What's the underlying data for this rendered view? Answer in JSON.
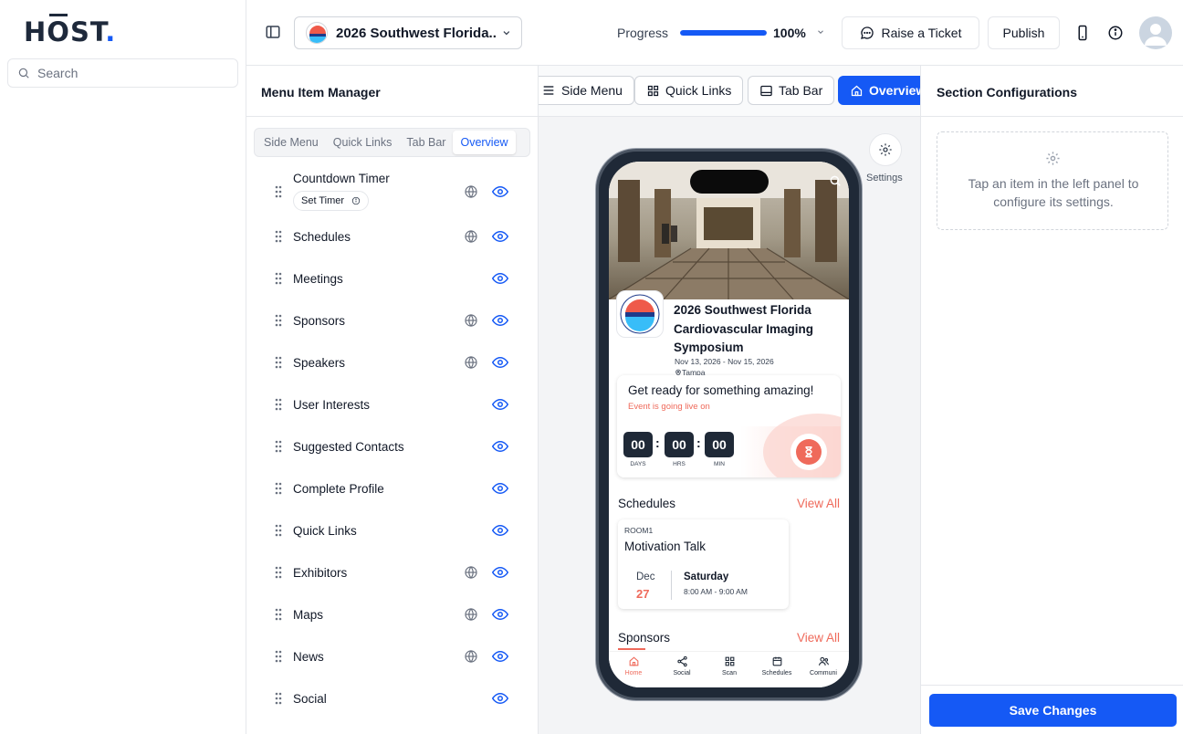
{
  "brand": {
    "logo_text": "HŌST",
    "logo_dot": "."
  },
  "sidebar": {
    "search_placeholder": "Search"
  },
  "topbar": {
    "event_name": "2026 Southwest Florida...",
    "progress_label": "Progress",
    "progress_value": "100%",
    "progress_fraction": 1.0,
    "raise_ticket_label": "Raise a Ticket",
    "publish_label": "Publish"
  },
  "manager": {
    "title": "Menu Item Manager",
    "segments": [
      "Side Menu",
      "Quick Links",
      "Tab Bar",
      "Overview"
    ],
    "active_segment": "Overview",
    "set_timer_label": "Set Timer",
    "items": [
      {
        "label": "Countdown Timer",
        "globe": true
      },
      {
        "label": "Schedules",
        "globe": true
      },
      {
        "label": "Meetings",
        "globe": false
      },
      {
        "label": "Sponsors",
        "globe": true
      },
      {
        "label": "Speakers",
        "globe": true
      },
      {
        "label": "User Interests",
        "globe": false
      },
      {
        "label": "Suggested Contacts",
        "globe": false
      },
      {
        "label": "Complete Profile",
        "globe": false
      },
      {
        "label": "Quick Links",
        "globe": false
      },
      {
        "label": "Exhibitors",
        "globe": true
      },
      {
        "label": "Maps",
        "globe": true
      },
      {
        "label": "News",
        "globe": true
      },
      {
        "label": "Social",
        "globe": false
      }
    ]
  },
  "preview": {
    "tabs": [
      "Side Menu",
      "Quick Links",
      "Tab Bar",
      "Overview"
    ],
    "active_tab": "Overview",
    "settings_label": "Settings",
    "phone": {
      "event_title": "2026 Southwest Florida Cardiovascular Imaging Symposium",
      "event_dates": "Nov 13, 2026 - Nov 15, 2026",
      "event_location": "Tampa",
      "countdown_heading": "Get ready for something amazing!",
      "countdown_sub": "Event is going live on",
      "countdown": [
        {
          "value": "00",
          "unit": "DAYS"
        },
        {
          "value": "00",
          "unit": "HRS"
        },
        {
          "value": "00",
          "unit": "MIN"
        }
      ],
      "schedules_title": "Schedules",
      "view_all": "View All",
      "session": {
        "room": "ROOM1",
        "title": "Motivation Talk",
        "month": "Dec",
        "day": "27",
        "weekday": "Saturday",
        "time": "8:00 AM - 9:00 AM"
      },
      "sponsors_title": "Sponsors",
      "tabbar": [
        "Home",
        "Social",
        "Scan",
        "Schedules",
        "Communi"
      ]
    }
  },
  "config": {
    "title": "Section Configurations",
    "hint": "Tap an item in the left panel to configure its settings.",
    "save_label": "Save Changes"
  },
  "colors": {
    "accent": "#1559f5",
    "coral": "#ef6a5b"
  }
}
